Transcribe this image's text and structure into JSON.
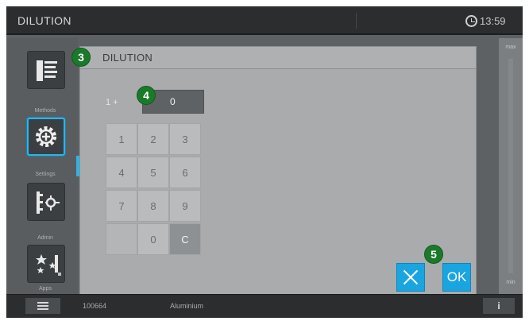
{
  "topbar": {
    "title": "DILUTION",
    "time": "13:59"
  },
  "sidebar": {
    "items": [
      {
        "label": "Methods",
        "icon": "methods-list-icon"
      },
      {
        "label": "Settings",
        "icon": "settings-gear-icon"
      },
      {
        "label": "Admin",
        "icon": "admin-network-icon"
      },
      {
        "label": "Apps",
        "icon": "apps-sparkle-icon"
      }
    ]
  },
  "dialog": {
    "title": "DILUTION",
    "ratio_prefix": "1 +",
    "ratio_value": "0",
    "keys": [
      "1",
      "2",
      "3",
      "4",
      "5",
      "6",
      "7",
      "8",
      "9",
      "",
      "0",
      "C"
    ],
    "cancel_icon": "close-icon",
    "ok_label": "OK"
  },
  "rightstrip": {
    "top_value": "max",
    "bottom_value": "min"
  },
  "bottombar": {
    "sample_id": "100664",
    "material": "Aluminium",
    "info_label": "i"
  },
  "callouts": [
    "3",
    "4",
    "5"
  ],
  "colors": {
    "accent": "#19a5e0",
    "callout": "#1a7a2a",
    "topbar": "#2b2d2f",
    "panel": "#a9abad"
  }
}
